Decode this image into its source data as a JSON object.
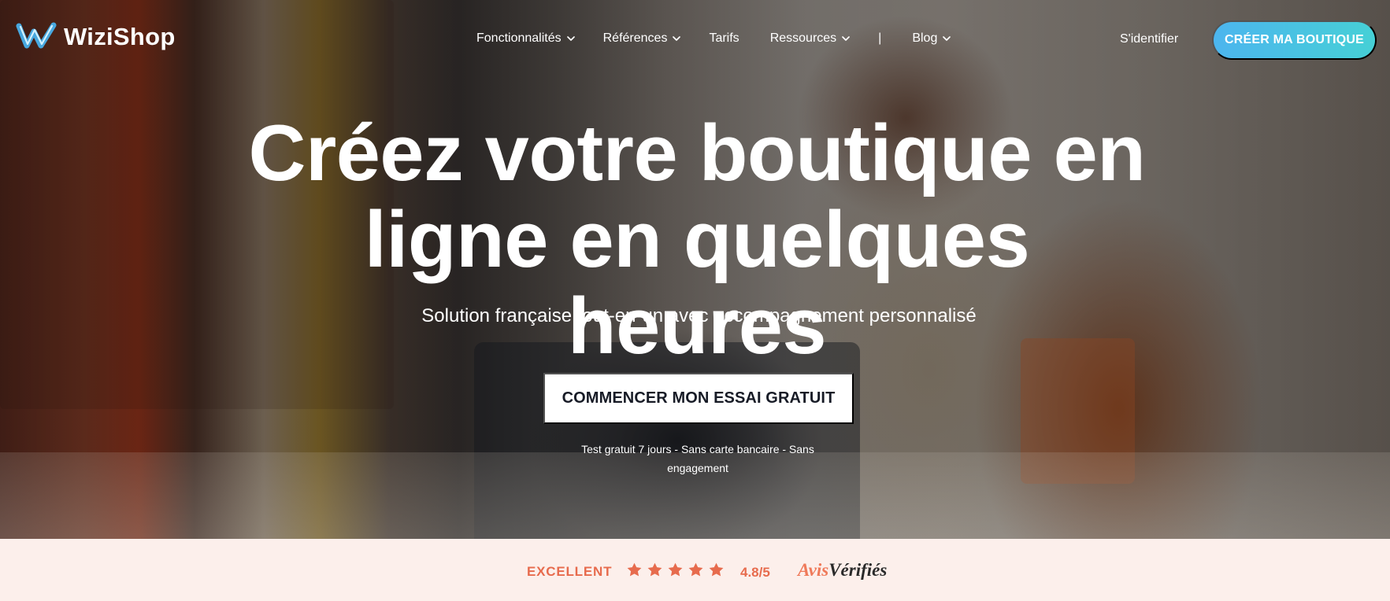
{
  "header": {
    "brand_name": "WiziShop",
    "nav": [
      {
        "label": "Fonctionnalités",
        "icon": "chevron-down-icon"
      },
      {
        "label": "Références",
        "icon": "chevron-down-icon"
      },
      {
        "label": "Tarifs",
        "icon": ""
      },
      {
        "label": "Ressources",
        "icon": "chevron-down-icon"
      },
      {
        "label": "|",
        "icon": ""
      },
      {
        "label": "Blog",
        "icon": "chevron-down-icon"
      }
    ],
    "signin_label": "S'identifier",
    "cta_label": "CRÉER MA BOUTIQUE",
    "cta_color": "#4cb5ee"
  },
  "hero": {
    "title_line_1": "Créez votre boutique en",
    "title_line_2": "ligne en quelques heures",
    "subtitle": "Solution française tout-en-un avec accompagnement personnalisé",
    "button_label": "COMMENCER MON ESSAI GRATUIT",
    "note_line_1": "Test gratuit 7 jours - Sans carte bancaire - Sans",
    "note_line_2": "engagement",
    "text_color": "#ffffff"
  },
  "rating": {
    "label": "EXCELLENT",
    "stars": 5,
    "score": "4.8/5",
    "brand_part_1": "Avis",
    "brand_part_2": "Vérifiés",
    "accent_color": "#e76b4d",
    "background_color": "#fcefeb"
  }
}
